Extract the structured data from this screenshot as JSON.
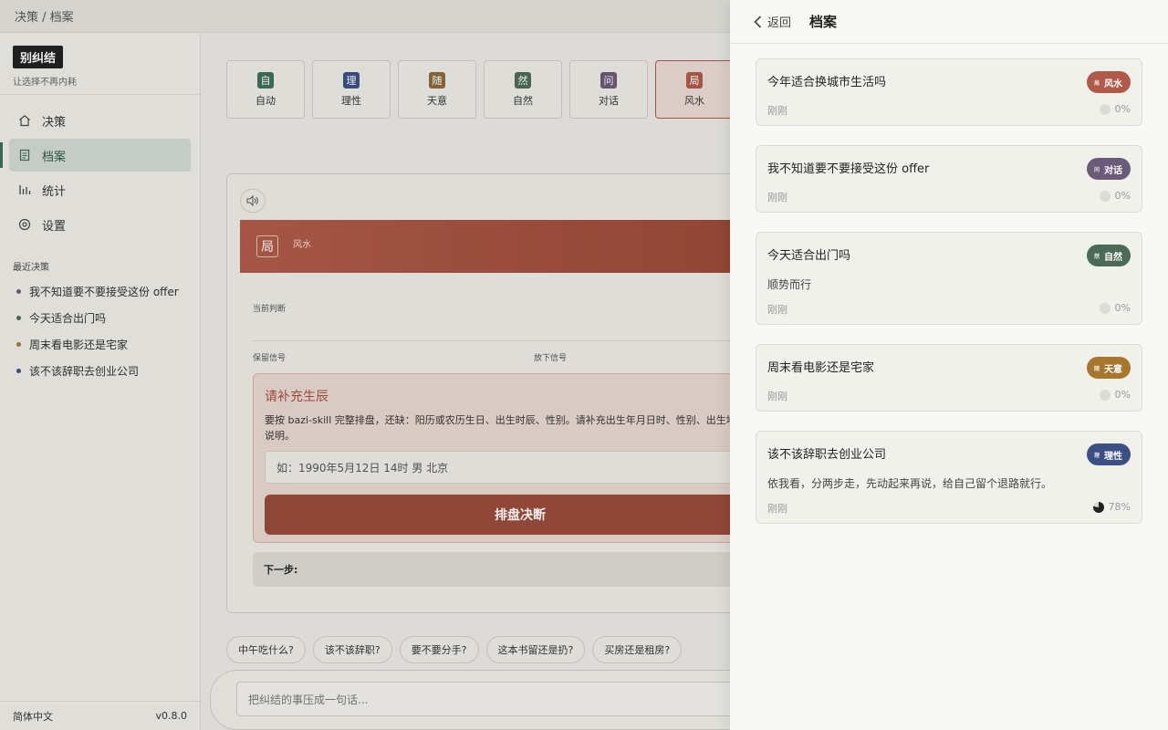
{
  "breadcrumb": "决策 / 档案",
  "brand": {
    "name": "别纠结",
    "tagline": "让选择不再内耗"
  },
  "nav": [
    {
      "label": "决策",
      "icon": "home-icon"
    },
    {
      "label": "档案",
      "icon": "archive-icon",
      "active": true
    },
    {
      "label": "统计",
      "icon": "stats-icon"
    },
    {
      "label": "设置",
      "icon": "settings-icon"
    }
  ],
  "recent": {
    "title": "最近决策",
    "items": [
      {
        "label": "我不知道要不要接受这份 offer",
        "color": "#6b5a78"
      },
      {
        "label": "今天适合出门吗",
        "color": "#4a6b55"
      },
      {
        "label": "周末看电影还是宅家",
        "color": "#a8772e"
      },
      {
        "label": "该不该辞职去创业公司",
        "color": "#3b4f85"
      }
    ]
  },
  "footer": {
    "language": "简体中文",
    "version": "v0.8.0"
  },
  "main": {
    "modes": [
      {
        "glyph": "自",
        "label": "自动",
        "color": "#3d6e5a"
      },
      {
        "glyph": "理",
        "label": "理性",
        "color": "#3b4f85"
      },
      {
        "glyph": "随",
        "label": "天意",
        "color": "#8a6a3a"
      },
      {
        "glyph": "然",
        "label": "自然",
        "color": "#4a6b55"
      },
      {
        "glyph": "问",
        "label": "对话",
        "color": "#6b5a78"
      },
      {
        "glyph": "局",
        "label": "风水",
        "color": "#b05a47",
        "active": true
      }
    ],
    "banner": {
      "glyph": "局",
      "label": "风水"
    },
    "judge_label": "当前判断",
    "keep_label": "保留信号",
    "drop_label": "放下信号",
    "birth": {
      "title": "请补充生辰",
      "desc": "要按 bazi-skill 完整排盘，还缺：阳历或农历生日、出生时辰、性别。请补充出生年月日时、性别、出生地，也请说明。",
      "placeholder": "如：1990年5月12日 14时 男 北京",
      "button": "排盘决断"
    },
    "next_label": "下一步:",
    "chips": [
      "中午吃什么?",
      "该不该辞职?",
      "要不要分手?",
      "这本书留还是扔?",
      "买房还是租房?"
    ],
    "composer_placeholder": "把纠结的事压成一句话..."
  },
  "drawer": {
    "back": "返回",
    "title": "档案",
    "entries": [
      {
        "title": "今年适合换城市生活吗",
        "badge": "风水",
        "badge_glyph": "局",
        "color": "#b05a47",
        "summary": "",
        "time": "刚刚",
        "progress": 0
      },
      {
        "title": "我不知道要不要接受这份 offer",
        "badge": "对话",
        "badge_glyph": "问",
        "color": "#6b5a78",
        "summary": "",
        "time": "刚刚",
        "progress": 0
      },
      {
        "title": "今天适合出门吗",
        "badge": "自然",
        "badge_glyph": "然",
        "color": "#4a6b55",
        "summary": "顺势而行",
        "time": "刚刚",
        "progress": 0
      },
      {
        "title": "周末看电影还是宅家",
        "badge": "天意",
        "badge_glyph": "随",
        "color": "#a8772e",
        "summary": "",
        "time": "刚刚",
        "progress": 0
      },
      {
        "title": "该不该辞职去创业公司",
        "badge": "理性",
        "badge_glyph": "理",
        "color": "#3b4f85",
        "summary": "依我看，分两步走，先动起来再说，给自己留个退路就行。",
        "time": "刚刚",
        "progress": 78
      }
    ]
  }
}
